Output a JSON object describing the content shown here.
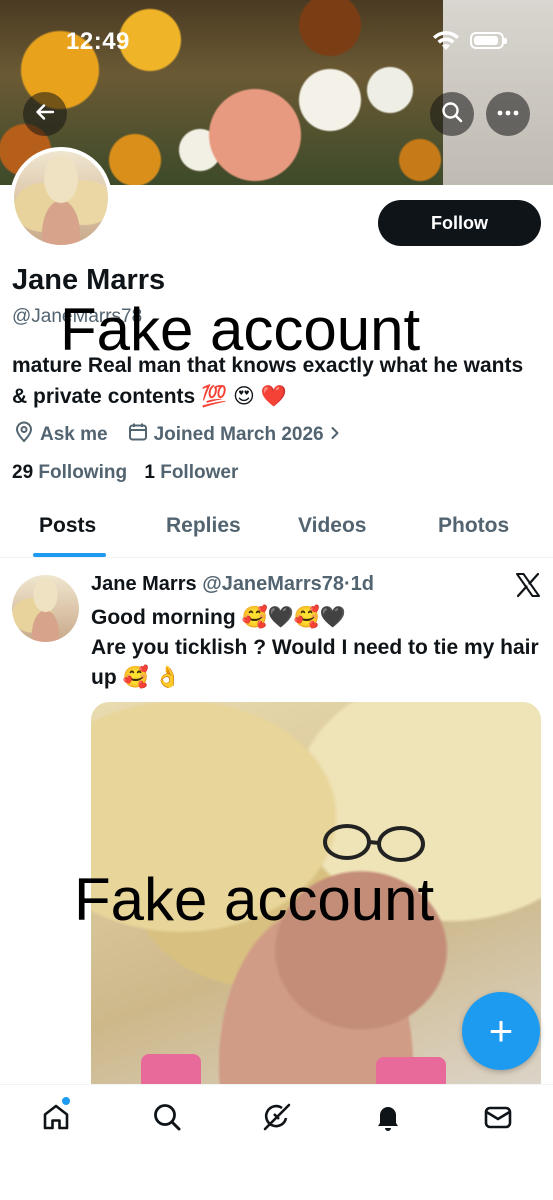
{
  "status_bar": {
    "time": "12:49"
  },
  "profile": {
    "name": "Jane Marrs",
    "handle": "@JaneMarrs78",
    "follow_label": "Follow",
    "bio": "mature Real man that knows exactly what he wants & private contents 💯 😍 ❤️",
    "website": "Ask me",
    "joined": "Joined March 2026",
    "following_count": "29",
    "following_label": "Following",
    "followers_count": "1",
    "followers_label": "Follower"
  },
  "overlay_text": "Fake account",
  "tabs": [
    {
      "label": "Posts",
      "active": true
    },
    {
      "label": "Replies",
      "active": false
    },
    {
      "label": "Videos",
      "active": false
    },
    {
      "label": "Photos",
      "active": false
    }
  ],
  "post": {
    "author_name": "Jane Marrs",
    "author_handle": "@JaneMarrs78",
    "separator": "·",
    "time": "1d",
    "line1": "Good morning 🥰🖤🥰🖤",
    "line2": "Are you ticklish ? Would I need to tie my hair up 🥰 👌",
    "source_icon": "x-logo-icon"
  },
  "fab_label": "+",
  "bottom_nav": [
    "home-icon",
    "search-icon",
    "grok-icon",
    "notifications-icon",
    "messages-icon"
  ],
  "colors": {
    "accent": "#1d9bf0",
    "text": "#0f1419",
    "secondary": "#536471",
    "button_dark": "#0f1419"
  }
}
